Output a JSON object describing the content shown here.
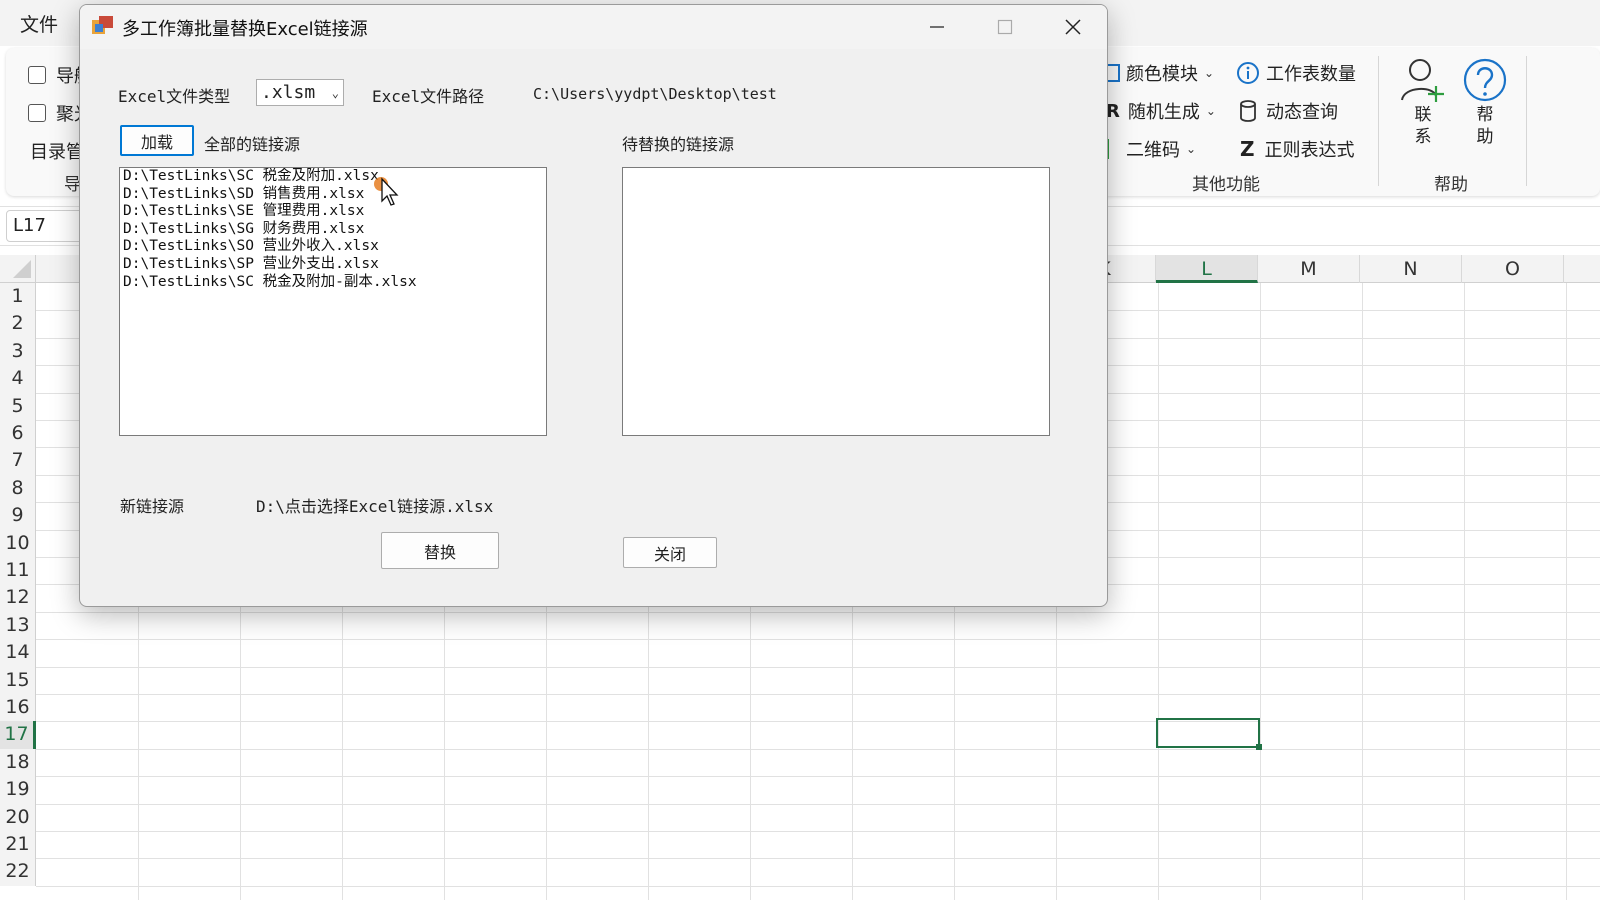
{
  "excel": {
    "menu_file": "文件",
    "left_group": {
      "checkbox1": "导航",
      "checkbox2": "聚光",
      "button": "目录管",
      "group_label": "导"
    },
    "other": {
      "color_module": "颜色模块",
      "random_gen": "随机生成",
      "qrcode": "二维码",
      "sheet_count": "工作表数量",
      "dynamic_query": "动态查询",
      "regex": "正则表达式",
      "group_label": "其他功能"
    },
    "help": {
      "contact": "联\n系",
      "help": "帮\n助",
      "group_label": "帮助"
    },
    "name_box": "L17",
    "columns": [
      "K",
      "L",
      "M",
      "N",
      "O"
    ],
    "active_column": "L",
    "rows": [
      "1",
      "2",
      "3",
      "4",
      "5",
      "6",
      "7",
      "8",
      "9",
      "10",
      "11",
      "12",
      "13",
      "14",
      "15",
      "16",
      "17",
      "18",
      "19",
      "20",
      "21",
      "22"
    ],
    "active_row": "17"
  },
  "dialog": {
    "title": "多工作簿批量替换Excel链接源",
    "file_type_label": "Excel文件类型",
    "file_type_value": ".xlsm",
    "file_path_label": "Excel文件路径",
    "file_path_value": "C:\\Users\\yydpt\\Desktop\\test",
    "load_button": "加载",
    "all_links_label": "全部的链接源",
    "pending_links_label": "待替换的链接源",
    "all_links": [
      "D:\\TestLinks\\SC 税金及附加.xlsx",
      "D:\\TestLinks\\SD 销售费用.xlsx",
      "D:\\TestLinks\\SE 管理费用.xlsx",
      "D:\\TestLinks\\SG 财务费用.xlsx",
      "D:\\TestLinks\\SO 营业外收入.xlsx",
      "D:\\TestLinks\\SP 营业外支出.xlsx",
      "D:\\TestLinks\\SC 税金及附加-副本.xlsx"
    ],
    "pending_links": [],
    "new_source_label": "新链接源",
    "new_source_value": "D:\\点击选择Excel链接源.xlsx",
    "replace_button": "替换",
    "close_button": "关闭"
  }
}
